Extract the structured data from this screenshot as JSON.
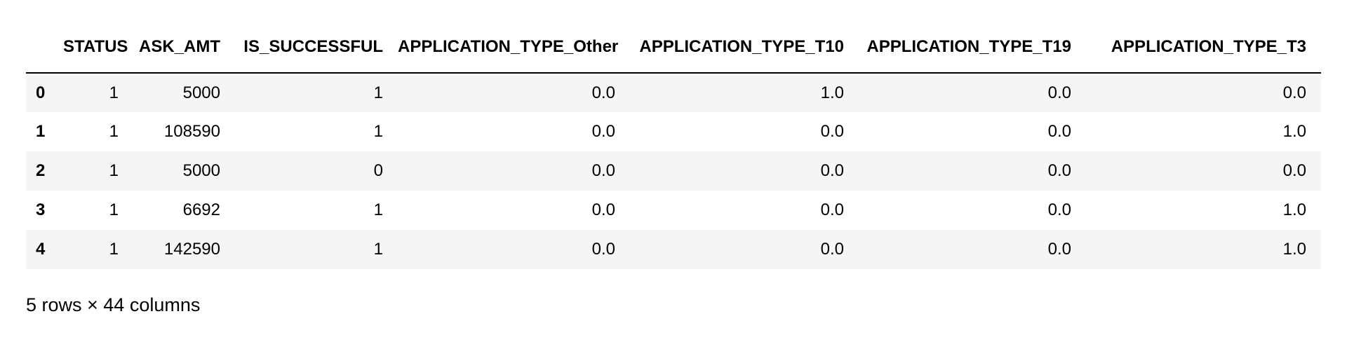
{
  "dataframe": {
    "columns": [
      "STATUS",
      "ASK_AMT",
      "IS_SUCCESSFUL",
      "APPLICATION_TYPE_Other",
      "APPLICATION_TYPE_T10",
      "APPLICATION_TYPE_T19",
      "APPLICATION_TYPE_T3"
    ],
    "rows": [
      {
        "index": "0",
        "cells": [
          "1",
          "5000",
          "1",
          "0.0",
          "1.0",
          "0.0",
          "0.0"
        ]
      },
      {
        "index": "1",
        "cells": [
          "1",
          "108590",
          "1",
          "0.0",
          "0.0",
          "0.0",
          "1.0"
        ]
      },
      {
        "index": "2",
        "cells": [
          "1",
          "5000",
          "0",
          "0.0",
          "0.0",
          "0.0",
          "0.0"
        ]
      },
      {
        "index": "3",
        "cells": [
          "1",
          "6692",
          "1",
          "0.0",
          "0.0",
          "0.0",
          "1.0"
        ]
      },
      {
        "index": "4",
        "cells": [
          "1",
          "142590",
          "1",
          "0.0",
          "0.0",
          "0.0",
          "1.0"
        ]
      }
    ],
    "shape_note": "5 rows × 44 columns"
  }
}
